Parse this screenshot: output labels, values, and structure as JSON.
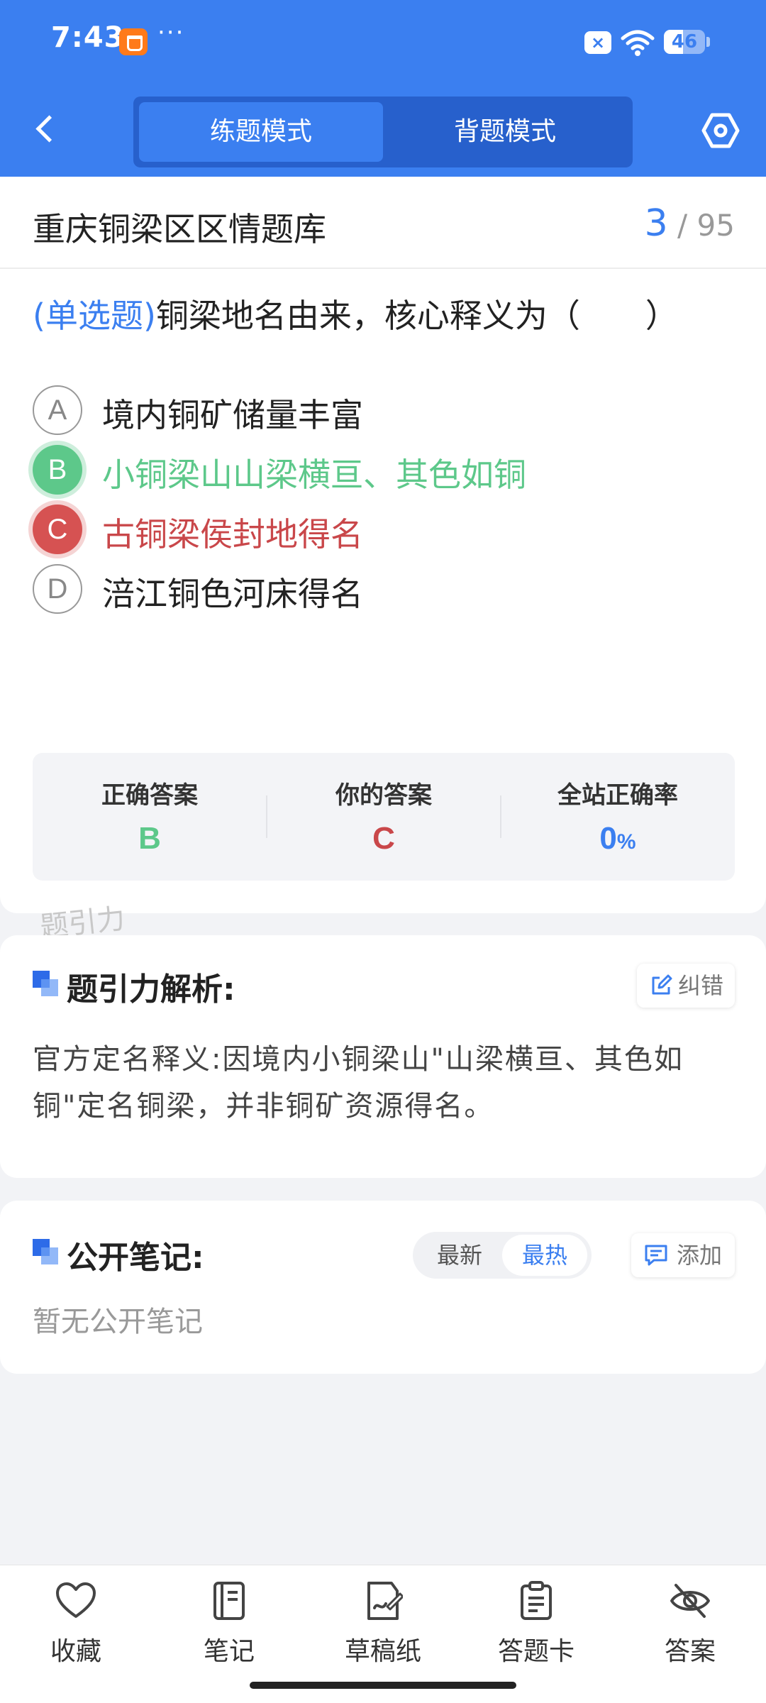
{
  "status_bar": {
    "time": "7:43",
    "more": "···",
    "sim_badge": "×",
    "battery_level": "46",
    "battery_fraction": 0.46
  },
  "header": {
    "modes": [
      "练题模式",
      "背题模式"
    ],
    "active_mode": "练题模式",
    "accent_color": "#3b7ff0"
  },
  "question_card": {
    "bank_title": "重庆铜梁区区情题库",
    "current_index": "3",
    "total_separator": "/",
    "total": "95",
    "question_type": "(单选题)",
    "question_text": "铜梁地名由来，核心释义为（　　）",
    "options": [
      {
        "letter": "A",
        "text": "境内铜矿储量丰富",
        "state": "normal"
      },
      {
        "letter": "B",
        "text": "小铜梁山山梁横亘、其色如铜",
        "state": "correct"
      },
      {
        "letter": "C",
        "text": "古铜梁侯封地得名",
        "state": "wrong"
      },
      {
        "letter": "D",
        "text": "涪江铜色河床得名",
        "state": "normal"
      }
    ],
    "stats": {
      "correct_label": "正确答案",
      "correct_value": "B",
      "yours_label": "你的答案",
      "yours_value": "C",
      "rate_label": "全站正确率",
      "rate_value": "0",
      "rate_unit": "%"
    },
    "colors": {
      "correct": "#5dc88a",
      "wrong": "#c9474a",
      "info": "#3b7ff0"
    }
  },
  "watermark": "题引力",
  "analysis": {
    "title": "题引力解析:",
    "report_label": "纠错",
    "text": "官方定名释义:因境内小铜梁山\"山梁横亘、其色如铜\"定名铜梁，并非铜矿资源得名。"
  },
  "notes": {
    "title": "公开笔记:",
    "sort_options": [
      "最新",
      "最热"
    ],
    "active_sort": "最热",
    "add_label": "添加",
    "empty_text": "暂无公开笔记"
  },
  "bottom_bar": {
    "items": [
      {
        "label": "收藏",
        "icon": "heart-icon"
      },
      {
        "label": "笔记",
        "icon": "notebook-icon"
      },
      {
        "label": "草稿纸",
        "icon": "draft-paper-icon"
      },
      {
        "label": "答题卡",
        "icon": "answer-sheet-icon"
      },
      {
        "label": "答案",
        "icon": "eye-off-icon"
      }
    ]
  }
}
